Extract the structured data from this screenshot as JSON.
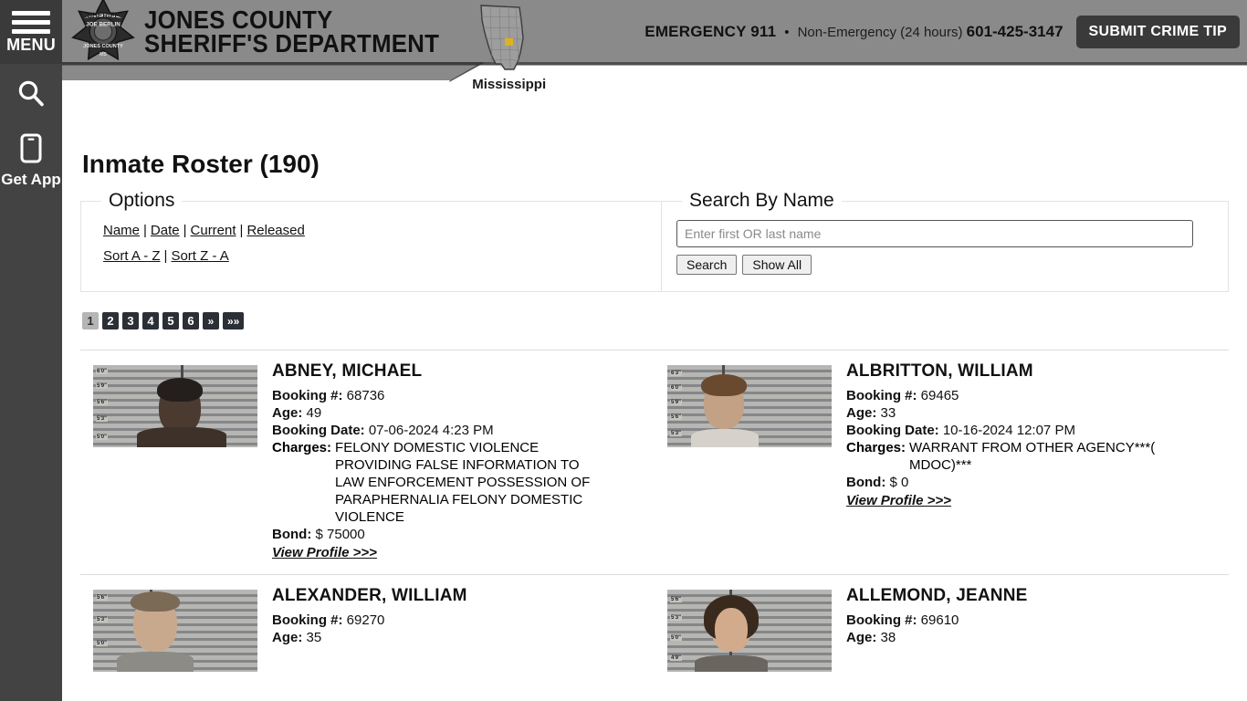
{
  "sidebar": {
    "menu_label": "MENU",
    "items": [
      {
        "name": "search",
        "icon": "search-icon",
        "label": ""
      },
      {
        "name": "get-app",
        "icon": "mobile-phone-icon",
        "label": "Get App"
      }
    ]
  },
  "header": {
    "badge_icon": "sheriff-star-badge-icon",
    "badge_text": [
      "SHERIFF",
      "JOE BERLIN",
      "JONES COUNTY",
      "MS"
    ],
    "title_line1": "JONES COUNTY",
    "title_line2": "SHERIFF'S DEPARTMENT",
    "state_label": "Mississippi",
    "state_icon": "mississippi-map-icon",
    "emergency": "EMERGENCY 911",
    "separator": "•",
    "non_emergency_label": "Non-Emergency (24 hours)",
    "non_emergency_phone": "601-425-3147",
    "crime_tip_button": "SUBMIT CRIME TIP",
    "bar_color": "#8a8a8a",
    "accent_dark": "#3a3a3a"
  },
  "main": {
    "page_title": "Inmate Roster (190)",
    "options": {
      "legend": "Options",
      "links_row1": [
        "Name",
        "Date",
        "Current",
        "Released"
      ],
      "links_row2": [
        "Sort A - Z",
        "Sort Z - A"
      ],
      "separator": "|"
    },
    "search": {
      "legend": "Search By Name",
      "placeholder": "Enter first OR last name",
      "value": "",
      "search_button": "Search",
      "show_all_button": "Show All"
    },
    "pagination": {
      "pages": [
        "1",
        "2",
        "3",
        "4",
        "5",
        "6"
      ],
      "active": "1",
      "next": "»",
      "last": "»»"
    },
    "labels": {
      "booking": "Booking #:",
      "age": "Age:",
      "booking_date": "Booking Date:",
      "charges": "Charges:",
      "bond": "Bond:",
      "view_profile": "View Profile >>>"
    },
    "inmates": [
      {
        "name": "ABNEY, MICHAEL",
        "booking": "68736",
        "age": "49",
        "booking_date": "07-06-2024 4:23 PM",
        "charges": "FELONY DOMESTIC VIOLENCE PROVIDING FALSE INFORMATION TO LAW ENFORCEMENT POSSESSION OF PARAPHERNALIA FELONY DOMESTIC VIOLENCE",
        "bond": "$ 75000",
        "mug_ticks": [
          "6'0\"",
          "5'9\"",
          "5'6\"",
          "5'3\"",
          "5'0\""
        ],
        "skin": "#4a3a30",
        "hair": "#22201e",
        "shirt": "#4d4038"
      },
      {
        "name": "ALBRITTON, WILLIAM",
        "booking": "69465",
        "age": "33",
        "booking_date": "10-16-2024 12:07 PM",
        "charges": "WARRANT FROM OTHER AGENCY***( MDOC)***",
        "bond": "$ 0",
        "mug_ticks": [
          "6'3\"",
          "6'0\"",
          "5'9\"",
          "5'6\"",
          "5'3\""
        ],
        "skin": "#c2a184",
        "hair": "#6a4a2e",
        "shirt": "#d8d4cd"
      },
      {
        "name": "ALEXANDER, WILLIAM",
        "booking": "69270",
        "age": "35",
        "booking_date": "",
        "charges": "",
        "bond": "",
        "mug_ticks": [
          "5'6\"",
          "5'3\"",
          "5'0\""
        ],
        "skin": "#c9a98d",
        "hair": "#7b6a56",
        "shirt": "#8d8b86"
      },
      {
        "name": "ALLEMOND, JEANNE",
        "booking": "69610",
        "age": "38",
        "booking_date": "",
        "charges": "",
        "bond": "",
        "mug_ticks": [
          "5'6\"",
          "5'3\"",
          "5'0\"",
          "4'9\""
        ],
        "skin": "#d2ab8c",
        "hair": "#3a2a1e",
        "shirt": "#6b6560"
      }
    ]
  }
}
